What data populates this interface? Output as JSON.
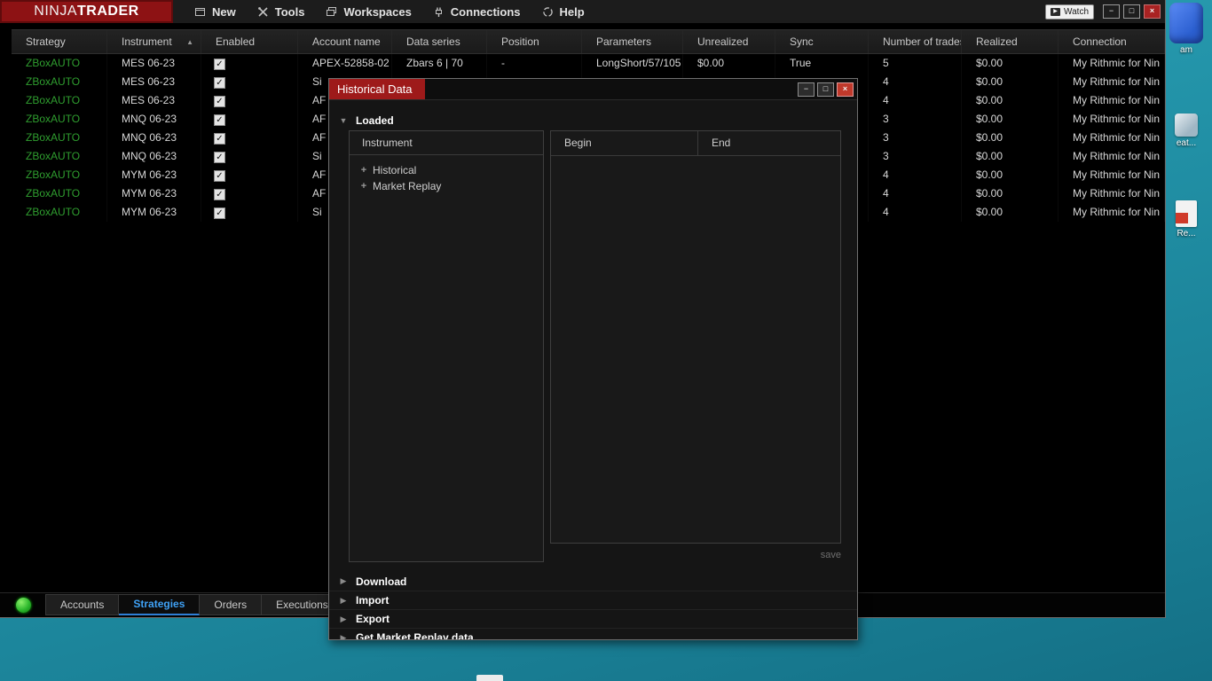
{
  "colors": {
    "accent_blue": "#3fa1f5",
    "dialog_title_red": "#9e1a1a",
    "strategy_green": "#2f9e2f",
    "status_green": "#2db82d",
    "desktop_teal": "#1d8ca2"
  },
  "icons": {
    "sort_asc": "▲",
    "expanded": "▼",
    "collapsed": "▶",
    "check": "✓",
    "plus": "+",
    "play": "▶",
    "minimize": "−",
    "maximize": "□",
    "close": "×"
  },
  "menubar": {
    "logo_part1": "NINJA",
    "logo_part2": "TRADER",
    "items": [
      {
        "label": "New",
        "icon": "new-icon"
      },
      {
        "label": "Tools",
        "icon": "tools-icon"
      },
      {
        "label": "Workspaces",
        "icon": "workspaces-icon"
      },
      {
        "label": "Connections",
        "icon": "connections-icon"
      },
      {
        "label": "Help",
        "icon": "help-icon"
      }
    ],
    "watch_label": "Watch"
  },
  "strategies_table": {
    "columns": [
      "Strategy",
      "Instrument",
      "Enabled",
      "Account name",
      "Data series",
      "Position",
      "Parameters",
      "Unrealized",
      "Sync",
      "Number of trades",
      "Realized",
      "Connection"
    ],
    "sorted_column": "Instrument",
    "rows": [
      {
        "strategy": "ZBoxAUTO",
        "instrument": "MES 06-23",
        "enabled": true,
        "account": "APEX-52858-02",
        "data_series": "Zbars 6 | 70",
        "position": "-",
        "parameters": "LongShort/57/105",
        "unrealized": "$0.00",
        "sync": "True",
        "trades": "5",
        "realized": "$0.00",
        "connection": "My Rithmic for Nin"
      },
      {
        "strategy": "ZBoxAUTO",
        "instrument": "MES 06-23",
        "enabled": true,
        "account": "Si",
        "data_series": "",
        "position": "",
        "parameters": "",
        "unrealized": "",
        "sync": "",
        "trades": "4",
        "realized": "$0.00",
        "connection": "My Rithmic for Nin"
      },
      {
        "strategy": "ZBoxAUTO",
        "instrument": "MES 06-23",
        "enabled": true,
        "account": "AF",
        "data_series": "",
        "position": "",
        "parameters": "",
        "unrealized": "",
        "sync": "",
        "trades": "4",
        "realized": "$0.00",
        "connection": "My Rithmic for Nin"
      },
      {
        "strategy": "ZBoxAUTO",
        "instrument": "MNQ 06-23",
        "enabled": true,
        "account": "AF",
        "data_series": "",
        "position": "",
        "parameters": "",
        "unrealized": "",
        "sync": "",
        "trades": "3",
        "realized": "$0.00",
        "connection": "My Rithmic for Nin"
      },
      {
        "strategy": "ZBoxAUTO",
        "instrument": "MNQ 06-23",
        "enabled": true,
        "account": "AF",
        "data_series": "",
        "position": "",
        "parameters": "",
        "unrealized": "",
        "sync": "",
        "trades": "3",
        "realized": "$0.00",
        "connection": "My Rithmic for Nin"
      },
      {
        "strategy": "ZBoxAUTO",
        "instrument": "MNQ 06-23",
        "enabled": true,
        "account": "Si",
        "data_series": "",
        "position": "",
        "parameters": "",
        "unrealized": "",
        "sync": "",
        "trades": "3",
        "realized": "$0.00",
        "connection": "My Rithmic for Nin"
      },
      {
        "strategy": "ZBoxAUTO",
        "instrument": "MYM 06-23",
        "enabled": true,
        "account": "AF",
        "data_series": "",
        "position": "",
        "parameters": "",
        "unrealized": "",
        "sync": "",
        "trades": "4",
        "realized": "$0.00",
        "connection": "My Rithmic for Nin"
      },
      {
        "strategy": "ZBoxAUTO",
        "instrument": "MYM 06-23",
        "enabled": true,
        "account": "AF",
        "data_series": "",
        "position": "",
        "parameters": "",
        "unrealized": "",
        "sync": "",
        "trades": "4",
        "realized": "$0.00",
        "connection": "My Rithmic for Nin"
      },
      {
        "strategy": "ZBoxAUTO",
        "instrument": "MYM 06-23",
        "enabled": true,
        "account": "Si",
        "data_series": "",
        "position": "",
        "parameters": "",
        "unrealized": "",
        "sync": "",
        "trades": "4",
        "realized": "$0.00",
        "connection": "My Rithmic for Nin"
      }
    ]
  },
  "dialog": {
    "title": "Historical Data",
    "loaded_label": "Loaded",
    "instrument_panel": {
      "header": "Instrument",
      "tree": [
        "Historical",
        "Market Replay"
      ]
    },
    "range_panel": {
      "begin_label": "Begin",
      "end_label": "End"
    },
    "save_label": "save",
    "collapsed_sections": [
      "Download",
      "Import",
      "Export",
      "Get Market Replay data"
    ]
  },
  "bottom_tabs": {
    "tabs": [
      {
        "label": "Accounts",
        "selected": false
      },
      {
        "label": "Strategies",
        "selected": true
      },
      {
        "label": "Orders",
        "selected": false
      },
      {
        "label": "Executions",
        "selected": false
      }
    ]
  },
  "desktop_icons": [
    {
      "label": "am"
    },
    {
      "label": "eat..."
    },
    {
      "label": "Re..."
    }
  ]
}
